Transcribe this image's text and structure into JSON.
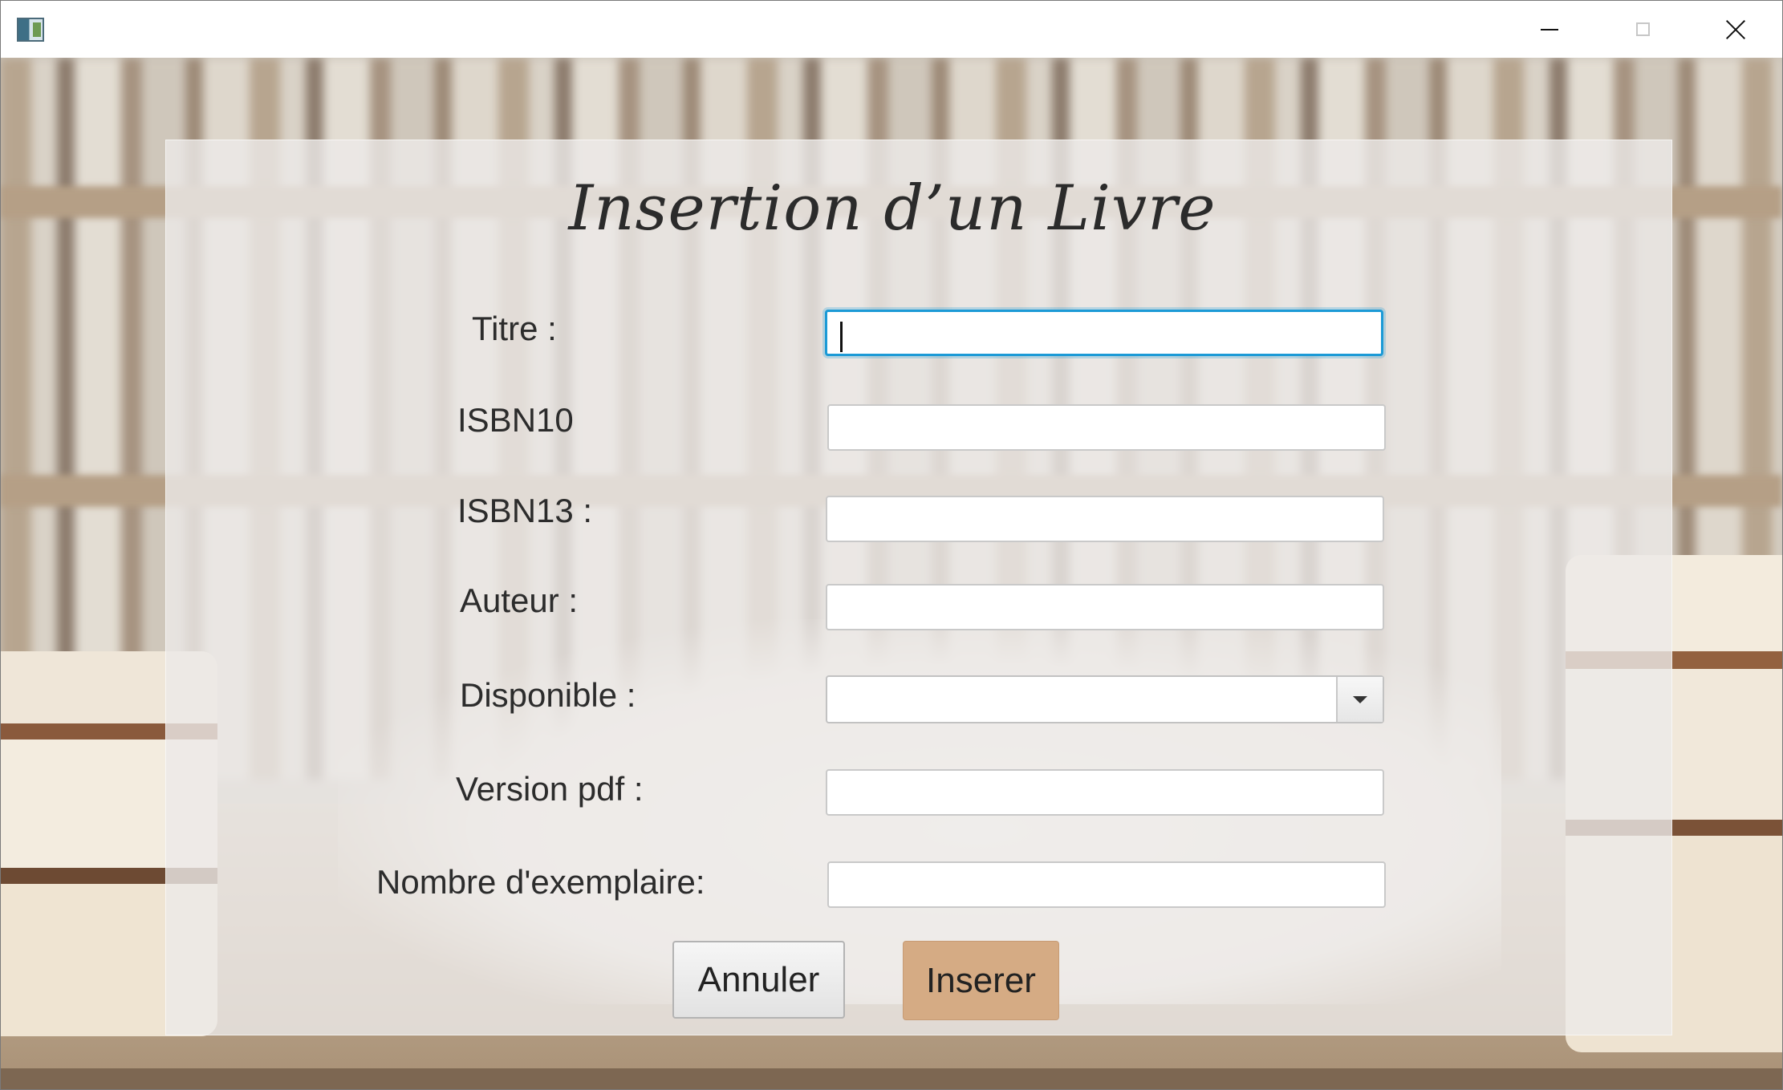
{
  "window": {
    "icon": "app-window-icon",
    "controls": {
      "minimize_icon": "minimize-icon",
      "maximize_icon": "maximize-icon",
      "close_icon": "close-icon"
    }
  },
  "form": {
    "title": "Insertion d’un Livre",
    "fields": {
      "titre": {
        "label": "Titre :",
        "value": ""
      },
      "isbn10": {
        "label": "ISBN10",
        "value": ""
      },
      "isbn13": {
        "label": "ISBN13 :",
        "value": ""
      },
      "auteur": {
        "label": "Auteur :",
        "value": ""
      },
      "disponible": {
        "label": "Disponible :",
        "value": ""
      },
      "version_pdf": {
        "label": "Version pdf :",
        "value": ""
      },
      "nombre_exemplaire": {
        "label": "Nombre d'exemplaire:",
        "value": ""
      }
    },
    "buttons": {
      "cancel": "Annuler",
      "insert": "Inserer"
    }
  },
  "colors": {
    "focus_border": "#1c9ad6",
    "insert_button": "#d5ab84",
    "panel_overlay": "#eceae8"
  }
}
